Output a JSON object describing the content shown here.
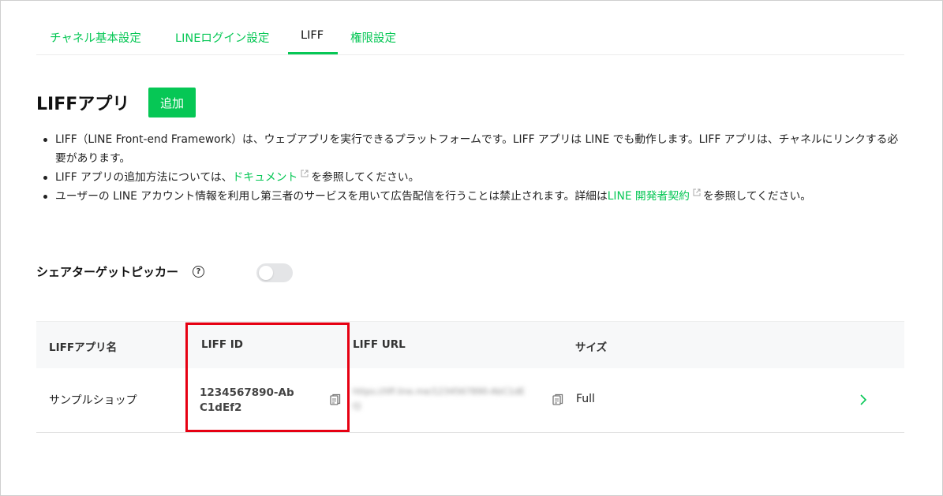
{
  "tabs": [
    {
      "label": "チャネル基本設定"
    },
    {
      "label": "LINEログイン設定"
    },
    {
      "label": "LIFF"
    },
    {
      "label": "権限設定"
    }
  ],
  "page": {
    "title": "LIFFアプリ",
    "add_label": "追加"
  },
  "bullets": {
    "b1": "LIFF（LINE Front-end Framework）は、ウェブアプリを実行できるプラットフォームです。LIFF アプリは LINE でも動作します。LIFF アプリは、チャネルにリンクする必要があります。",
    "b2_pre": "LIFF アプリの追加方法については、",
    "b2_link": "ドキュメント",
    "b2_post": "を参照してください。",
    "b3_pre": "ユーザーの LINE アカウント情報を利用し第三者のサービスを用いて広告配信を行うことは禁止されます。詳細は",
    "b3_link": "LINE 開発者契約",
    "b3_post": "を参照してください。"
  },
  "share_picker": {
    "label": "シェアターゲットピッカー",
    "help": "?",
    "enabled": false
  },
  "table": {
    "headers": {
      "name": "LIFFアプリ名",
      "id": "LIFF ID",
      "url": "LIFF URL",
      "size": "サイズ"
    },
    "rows": [
      {
        "name": "サンプルショップ",
        "id": "1234567890-AbC1dEf2",
        "url": "https://liff.line.me/1234567890-AbC1dEf2",
        "size": "Full"
      }
    ]
  },
  "colors": {
    "accent": "#06c755",
    "highlight": "#e60012"
  }
}
